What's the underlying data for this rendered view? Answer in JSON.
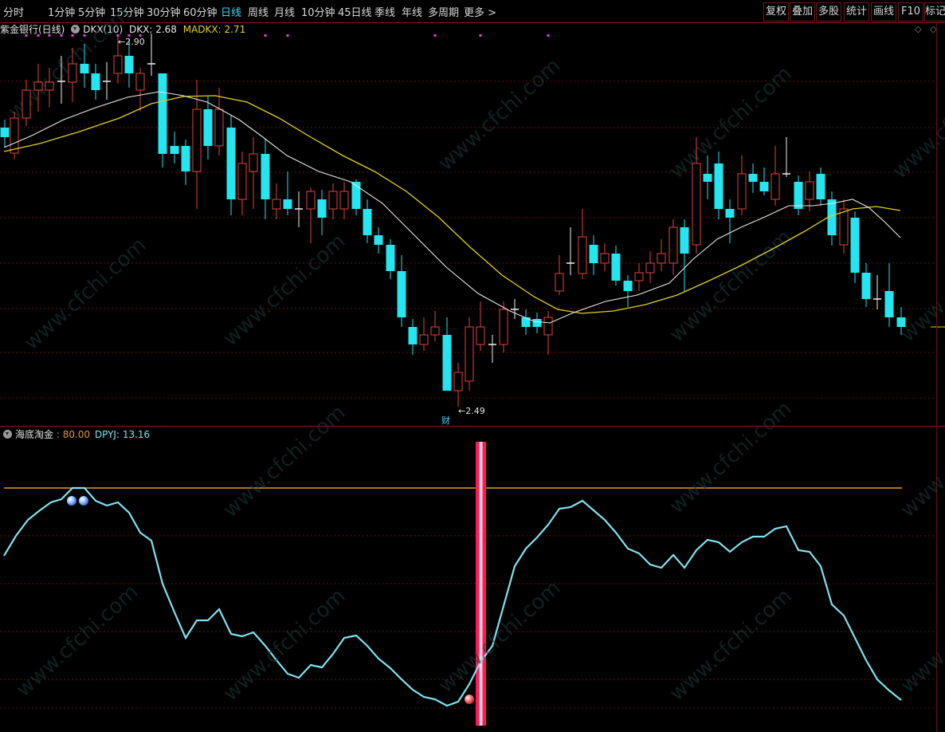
{
  "toolbar": {
    "periods": [
      "分时",
      "1分钟",
      "5分钟",
      "15分钟",
      "30分钟",
      "60分钟",
      "日线",
      "周线",
      "月线",
      "10分钟",
      "45日线",
      "季线",
      "年线",
      "多周期",
      "更多 >"
    ],
    "active_period": "日线",
    "right_buttons": [
      "复权",
      "叠加",
      "多股",
      "统计",
      "画线",
      "F10",
      "标记"
    ]
  },
  "main_panel": {
    "stock_name": "紫金银行(日线)",
    "indicator_name": "DKX(10)",
    "dkx_label": "DKX: 2.68",
    "madkx_label": "MADKX: 2.71",
    "high_marker": "2.90",
    "low_marker": "2.49",
    "event_badge": "财",
    "watermark": "www.cfchi.com"
  },
  "sub_panel": {
    "indicator_name": "海底淘金",
    "value_label": ": 80.00",
    "dpyj_label": "DPYJ: 13.16"
  },
  "colors": {
    "up_candle": "#e0463c",
    "down_candle": "#25e5f0",
    "dkx_line": "#e8e8e8",
    "madkx_line": "#e0d21a",
    "indicator_line": "#7ee3f0",
    "threshold_line": "#e09a2a",
    "signal_bar": "#ff1a55",
    "grid": "#6a0f0f"
  }
}
